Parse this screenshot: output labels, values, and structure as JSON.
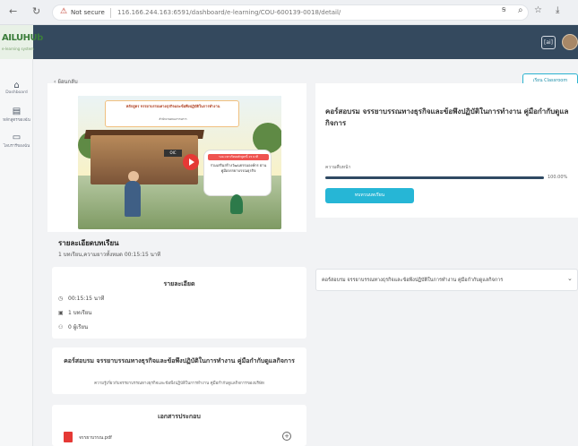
{
  "browser": {
    "security_label": "Not secure",
    "url": "116.166.244.163:6591/dashboard/e-learning/COU-600139-0018/detail/"
  },
  "logo": {
    "text": "AILUHUb",
    "sub": "e-learning system"
  },
  "header": {
    "chip": "[ai]"
  },
  "sidebar": {
    "items": [
      {
        "label": "Dashboard",
        "icon": "home-icon"
      },
      {
        "label": "หลักสูตรของฉัน",
        "icon": "book-icon"
      },
      {
        "label": "ไลบรารีของฉัน",
        "icon": "library-icon"
      }
    ]
  },
  "back": {
    "label": "ย้อนกลับ"
  },
  "classroom_button": {
    "label": "เรียน Classroom"
  },
  "video": {
    "title": "หลักสูตร จรรยาบรรณทางธุรกิจและข้อพึงปฏิบัติในการทำงาน",
    "subtitle": "สำนักงานคณะกรรมการ",
    "badge": "OIC",
    "bubble_header": "ระยะเวลาเรียนหลักสูตรนี้ 15 นาที",
    "bubble_text": "ร่วมเสริมสร้างวัฒนธรรมองค์กร ผ่านคู่มือจรรยาบรรณธุรกิจ"
  },
  "course": {
    "name": "รายละเอียดบทเรียน",
    "meta": "1 บทเรียน,ความยาวทั้งหมด 00:15:15 นาที"
  },
  "progress_card": {
    "title": "คอร์สอบรม จรรยาบรรณทางธุรกิจและข้อพึงปฏิบัติในการทำงาน คู่มือกำกับดูแลกิจการ",
    "progress_label": "ความคืบหน้า",
    "progress_value": "100.00%",
    "progress_fraction": 1.0,
    "button_label": "ทบทวนบทเรียน"
  },
  "lesson_select": {
    "value": "คอร์สอบรม จรรยาบรรณทางธุรกิจและข้อพึงปฏิบัติในการทำงาน คู่มือกำกับดูแลกิจการ"
  },
  "details": {
    "title": "รายละเอียด",
    "duration": "00:15:15 นาที",
    "lessons": "1 บทเรียน",
    "learners": "0 ผู้เรียน"
  },
  "description": {
    "title": "คอร์สอบรม จรรยาบรรณทางธุรกิจและข้อพึงปฏิบัติในการทำงาน คู่มือกำกับดูแลกิจการ",
    "body": "ความรู้เกี่ยวกับจรรยาบรรณทางธุรกิจและข้อพึงปฏิบัติในการทำงาน คู่มือกำกับดูแลกิจการของบริษัท"
  },
  "documents": {
    "title": "เอกสารประกอบ",
    "files": [
      {
        "name": "จรรยาบรรณ.pdf"
      }
    ]
  },
  "colors": {
    "header_bg": "#34495e",
    "accent": "#26b6d6",
    "progress_fill": "#2f4a63",
    "pdf_red": "#e53935"
  }
}
